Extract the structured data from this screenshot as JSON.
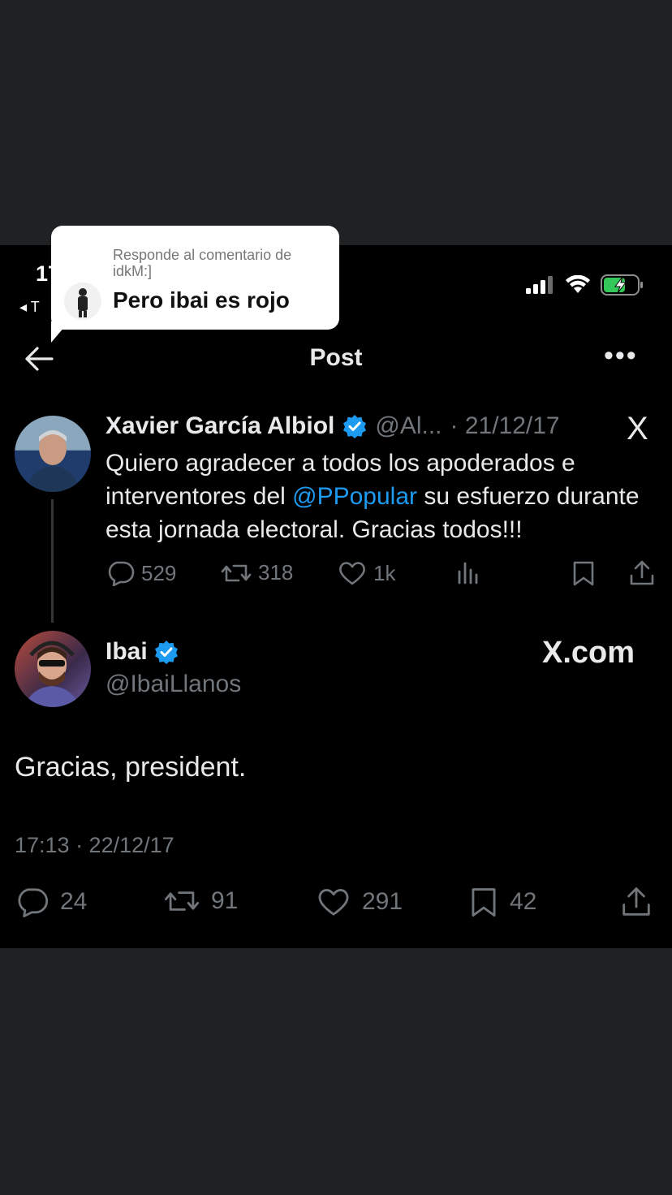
{
  "status": {
    "time": "17",
    "back_app": "◂ T"
  },
  "reply_bubble": {
    "context": "Responde al comentario de idkM:]",
    "text": "Pero ibai es rojo"
  },
  "header": {
    "title": "Post",
    "more": "•••"
  },
  "quoted_tweet": {
    "name": "Xavier García Albiol",
    "handle": "@Al...",
    "date": "· 21/12/17",
    "logo": "X",
    "text_before": "Quiero agradecer a todos los apoderados e interventores del ",
    "mention": "@PPopular",
    "text_after": " su esfuerzo durante esta jornada electoral. Gracias todos!!!",
    "replies": "529",
    "reposts": "318",
    "likes": "1k"
  },
  "main_tweet": {
    "name": "Ibai",
    "handle": "@IbaiLlanos",
    "watermark": "X.com",
    "text": "Gracias, president.",
    "meta": "17:13 · 22/12/17",
    "replies": "24",
    "reposts": "91",
    "likes": "291",
    "bookmarks": "42"
  },
  "colors": {
    "background": "#000000",
    "accent": "#1d9bf0",
    "secondary_text": "#71767b",
    "frame": "#202123"
  }
}
